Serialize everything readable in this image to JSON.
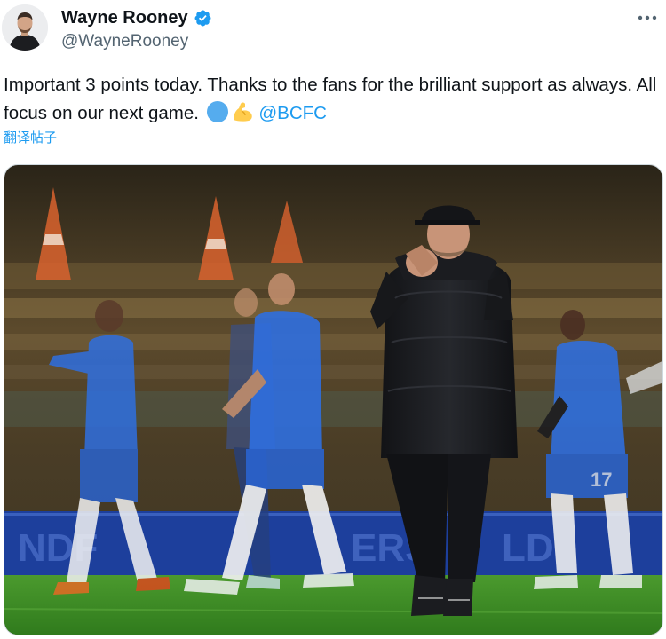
{
  "tweet": {
    "author": {
      "display_name": "Wayne Rooney",
      "handle": "@WayneRooney",
      "verified": true
    },
    "text": {
      "main": "Important 3 points today. Thanks to the fans for the brilliant support as always. All focus on our next game.",
      "mention": "@BCFC"
    },
    "translate_label": "翻译帖子",
    "icons": {
      "avatar": "avatar",
      "verified": "verified-badge-icon",
      "more": "more-options-icon",
      "emoji_1": "blue-circle-emoji",
      "emoji_2": "flexed-biceps-emoji"
    },
    "colors": {
      "accent": "#1d9bf0",
      "text": "#0f1419",
      "secondary": "#536471",
      "kit_blue": "#1f5fd6",
      "pitch_green": "#3c8a24"
    }
  }
}
